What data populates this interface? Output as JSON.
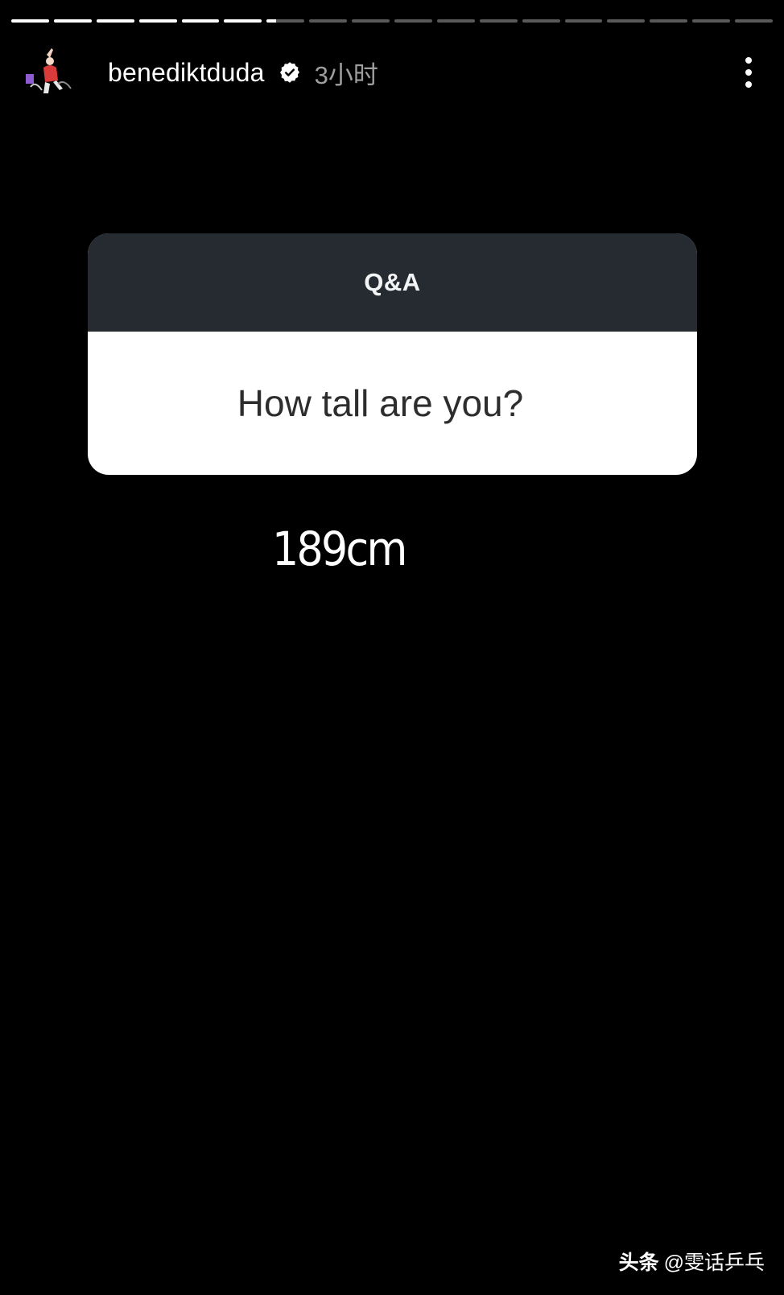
{
  "story": {
    "progress": {
      "segment_count": 18,
      "completed_segments": 6,
      "current_segment_progress": 0.25
    },
    "author": {
      "username": "benediktduda",
      "verified": true,
      "posted_time": "3小时"
    },
    "more_menu": {
      "icon": "more-vertical-icon"
    },
    "qa_sticker": {
      "title": "Q&A",
      "question": "How tall are you?",
      "header_color": "#262a31"
    },
    "answer_text": "189cm",
    "watermark": {
      "brand": "头条",
      "handle": "@雯话乒乓"
    }
  }
}
